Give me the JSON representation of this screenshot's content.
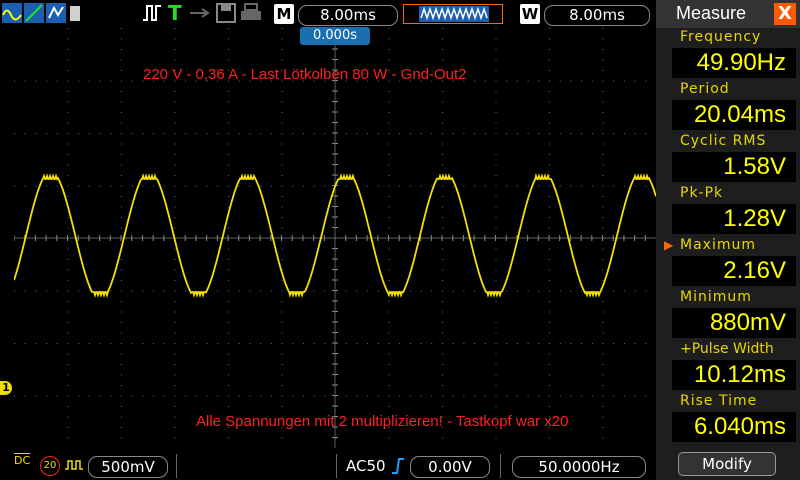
{
  "topbar": {
    "mode_letter": "T",
    "time_mode_letter": "M",
    "time_base": "8.00ms",
    "window_letter": "W",
    "window_time": "8.00ms"
  },
  "scope": {
    "trigger_position": "0.000s",
    "channel_marker": "1",
    "annotation_top": "220 V - 0,36 A - Last Lötkolben 80 W - Gnd-Out2",
    "annotation_bottom": "Alle Spannungen mit 2 multiplizieren! - Tastkopf war x20"
  },
  "panel": {
    "title": "Measure",
    "close_label": "X",
    "measurements": [
      {
        "label": "Frequency",
        "value": "49.90Hz"
      },
      {
        "label": "Period",
        "value": "20.04ms"
      },
      {
        "label": "Cyclic RMS",
        "value": "1.58V"
      },
      {
        "label": "Pk-Pk",
        "value": "1.28V"
      },
      {
        "label": "Maximum",
        "value": "2.16V",
        "selected": true
      },
      {
        "label": "Minimum",
        "value": "880mV"
      },
      {
        "label": "+Pulse Width",
        "value": "10.12ms"
      },
      {
        "label": "Rise Time",
        "value": "6.040ms"
      }
    ],
    "modify_label": "Modify"
  },
  "bottombar": {
    "coupling": "DC",
    "bandwidth_limit": "20",
    "volts_per_div": "500mV",
    "trigger_mode": "AC50",
    "trigger_level": "0.00V",
    "trigger_frequency": "50.0000Hz"
  },
  "colors": {
    "trace": "#f5e100",
    "annotation": "#ff2020",
    "label": "#e8d600",
    "value": "#ffff00",
    "accent": "#ff5a00"
  }
}
